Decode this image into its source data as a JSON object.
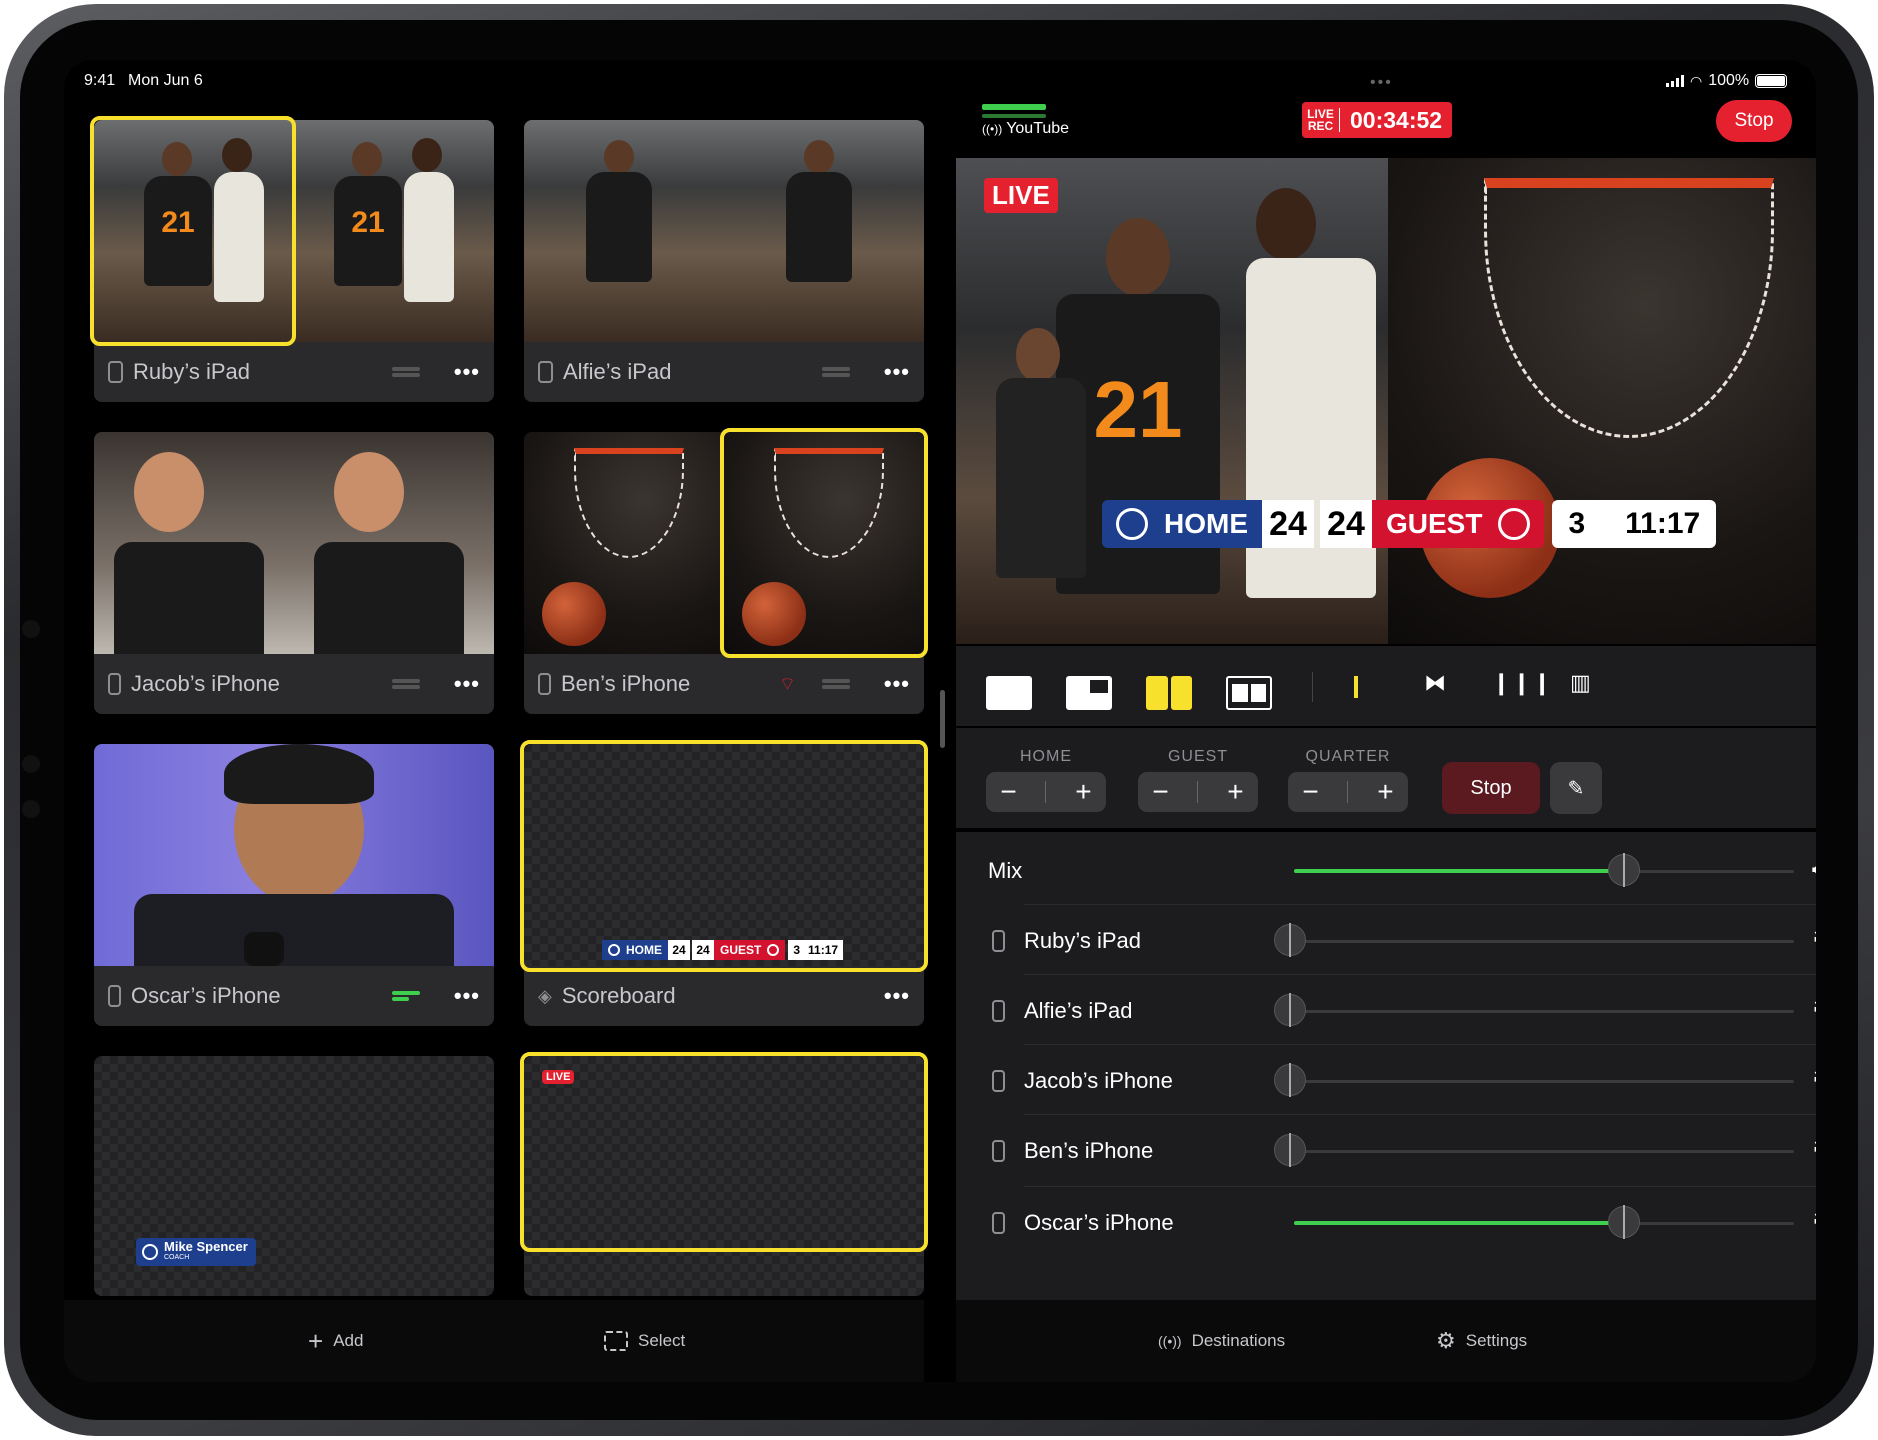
{
  "status_bar": {
    "time": "9:41",
    "date": "Mon Jun 6",
    "battery": "100%",
    "grabber": "•••"
  },
  "sources": [
    {
      "label": "Ruby’s iPad",
      "more": "•••"
    },
    {
      "label": "Alfie’s iPad",
      "more": "•••"
    },
    {
      "label": "Jacob’s iPhone",
      "more": "•••"
    },
    {
      "label": "Ben’s iPhone",
      "more": "•••"
    },
    {
      "label": "Oscar’s iPhone",
      "more": "•••"
    },
    {
      "label": "Scoreboard",
      "more": "•••"
    }
  ],
  "mini_scoreboard": {
    "home": "HOME",
    "home_score": "24",
    "guest_score": "24",
    "guest": "GUEST",
    "quarter": "3",
    "clock": "11:17"
  },
  "lower_third": {
    "name": "Mike Spencer",
    "role": "COACH"
  },
  "mini_live": "LIVE",
  "left_toolbar": {
    "add": "Add",
    "select": "Select"
  },
  "broadcast": {
    "destination": "YouTube",
    "rec_line1": "LIVE",
    "rec_line2": "REC",
    "timer": "00:34:52",
    "stop": "Stop"
  },
  "preview": {
    "live": "LIVE",
    "home": "HOME",
    "home_score": "24",
    "guest_score": "24",
    "guest": "GUEST",
    "quarter": "3",
    "clock": "11:17",
    "jersey_number": "21"
  },
  "score_controls": {
    "home_label": "HOME",
    "guest_label": "GUEST",
    "quarter_label": "QUARTER",
    "minus": "−",
    "plus": "+",
    "stop": "Stop"
  },
  "audio": {
    "mix_label": "Mix",
    "mix_level": 0.66,
    "channels": [
      {
        "name": "Ruby’s iPad",
        "level": 0.0
      },
      {
        "name": "Alfie’s iPad",
        "level": 0.0
      },
      {
        "name": "Jacob’s iPhone",
        "level": 0.0
      },
      {
        "name": "Ben’s iPhone",
        "level": 0.0
      },
      {
        "name": "Oscar’s iPhone",
        "level": 0.66
      }
    ]
  },
  "right_toolbar": {
    "destinations": "Destinations",
    "settings": "Settings"
  },
  "colors": {
    "accent_yellow": "#f7e12c",
    "live_red": "#e5212f",
    "level_green": "#3ecf4f",
    "home_blue": "#1e3f8e",
    "guest_red": "#d3122f"
  }
}
